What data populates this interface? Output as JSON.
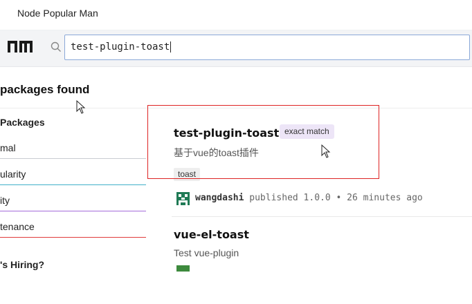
{
  "window": {
    "title": "Node Popular Man"
  },
  "search": {
    "value": "test-plugin-toast"
  },
  "summary": {
    "found_text": "packages found"
  },
  "sidebar": {
    "heading": "Packages",
    "sort_options": [
      {
        "label": "mal",
        "underline_color": "#c9ccd1"
      },
      {
        "label": "ularity",
        "underline_color": "#3fb0c8"
      },
      {
        "label": "ity",
        "underline_color": "#a36ad9"
      },
      {
        "label": "tenance",
        "underline_color": "#e03a3a"
      }
    ],
    "hiring": "'s Hiring?"
  },
  "results": [
    {
      "name": "test-plugin-toast",
      "badge": "exact match",
      "description": "基于vue的toast插件",
      "keywords": [
        "toast"
      ],
      "author": "wangdashi",
      "published": "published 1.0.0 • 26 minutes ago"
    },
    {
      "name": "vue-el-toast",
      "description": "Test vue-plugin"
    }
  ],
  "colors": {
    "accent_border": "#8aa8d8",
    "highlight": "#dd2222",
    "badge_bg": "#ede5f7"
  },
  "icons": {
    "search": "search-icon",
    "logo": "npm-logo",
    "avatar": "author-avatar-icon",
    "cursor": "mouse-pointer-icon"
  }
}
